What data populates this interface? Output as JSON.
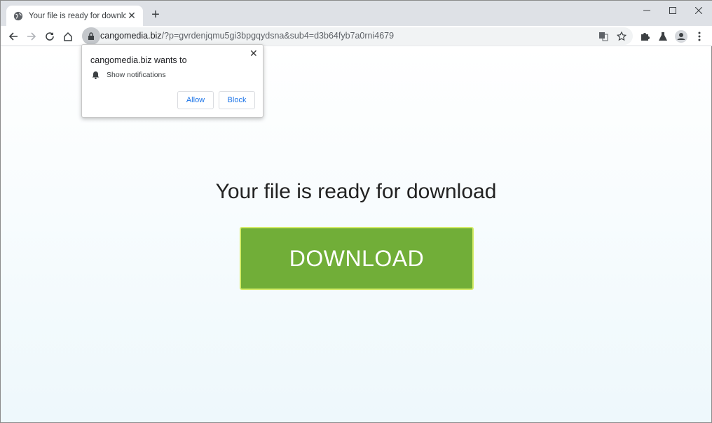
{
  "browser": {
    "tab": {
      "title": "Your file is ready for download",
      "close_glyph": "✕"
    },
    "new_tab_glyph": "+",
    "window_controls": {
      "minimize": "—",
      "maximize": "☐",
      "close": "✕"
    },
    "url": {
      "host": "cangomedia.biz",
      "path": "/?p=gvrdenjqmu5gi3bpgqydsna&sub4=d3b64fyb7a0rni4679"
    }
  },
  "popup": {
    "title": "cangomedia.biz wants to",
    "permission": "Show notifications",
    "allow_label": "Allow",
    "block_label": "Block",
    "close_glyph": "✕"
  },
  "page": {
    "headline": "Your file is ready for download",
    "download_label": "DOWNLOAD",
    "colors": {
      "button": "#71ae38",
      "button_border": "#d4ec68"
    }
  }
}
